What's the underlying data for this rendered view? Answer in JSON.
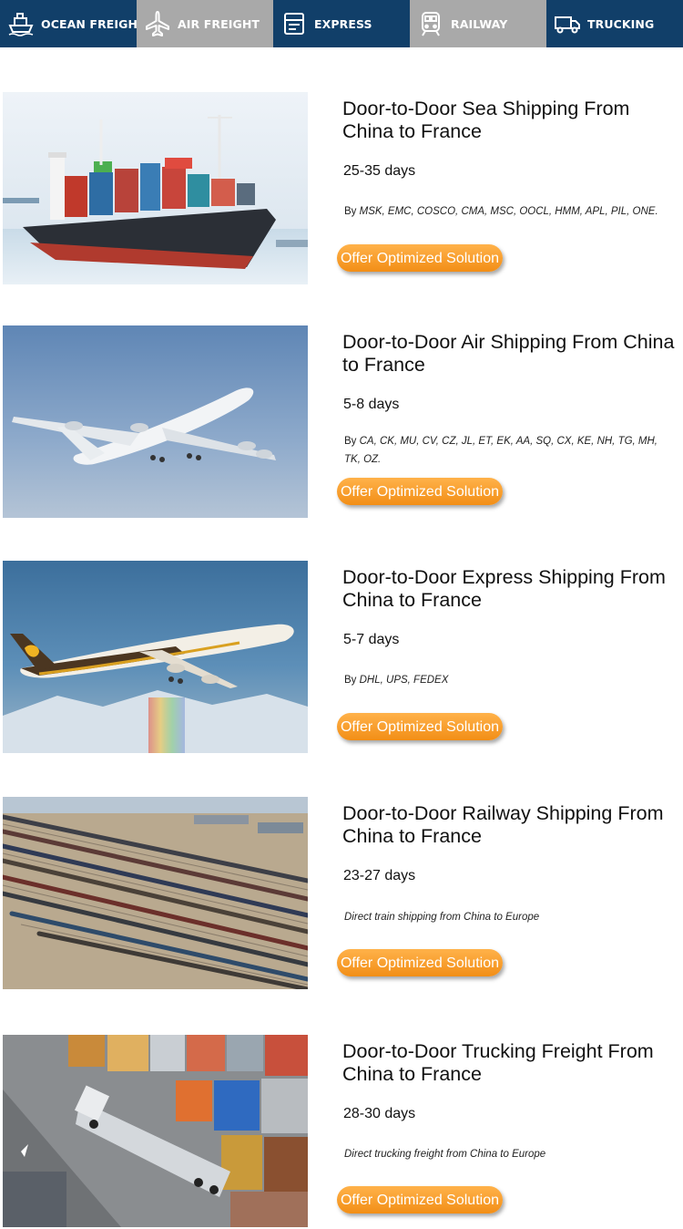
{
  "colors": {
    "tab_active": "#113f69",
    "tab_inactive": "#a9a9a9",
    "cta": "#f7951d"
  },
  "tabs": [
    {
      "label": "OCEAN FREIGHT",
      "icon": "ship-icon",
      "state": "dark"
    },
    {
      "label": "AIR FREIGHT",
      "icon": "airplane-icon",
      "state": "light"
    },
    {
      "label": "EXPRESS",
      "icon": "package-icon",
      "state": "dark"
    },
    {
      "label": "RAILWAY",
      "icon": "train-icon",
      "state": "light"
    },
    {
      "label": "TRUCKING",
      "icon": "truck-icon",
      "state": "dark"
    }
  ],
  "services": [
    {
      "title": "Door-to-Door Sea Shipping From China to France",
      "duration": "25-35 days",
      "carriers_prefix": "By",
      "carriers": "MSK, EMC, COSCO, CMA, MSC, OOCL, HMM, APL, PIL, ONE.",
      "cta": "Offer Optimized Solution",
      "image": "container-ship-photo"
    },
    {
      "title": "Door-to-Door Air Shipping From China to France",
      "duration": "5-8 days",
      "carriers_prefix": "By",
      "carriers": "CA, CK, MU, CV, CZ, JL, ET, EK, AA, SQ, CX, KE, NH, TG, MH, TK, OZ.",
      "cta": "Offer Optimized Solution",
      "image": "cargo-airplane-photo"
    },
    {
      "title": "Door-to-Door Express Shipping From China to France",
      "duration": "5-7 days",
      "carriers_prefix": "By",
      "carriers": "DHL, UPS, FEDEX",
      "cta": "Offer Optimized Solution",
      "image": "ups-airplane-photo"
    },
    {
      "title": "Door-to-Door Railway Shipping From China to France",
      "duration": "23-27 days",
      "carriers_prefix": "",
      "carriers": "Direct train shipping from China to Europe",
      "cta": "Offer Optimized Solution",
      "image": "rail-yard-photo"
    },
    {
      "title": "Door-to-Door Trucking Freight From China to France",
      "duration": "28-30 days",
      "carriers_prefix": "",
      "carriers": "Direct trucking freight from China to Europe",
      "cta": "Offer Optimized Solution",
      "image": "container-truck-photo"
    }
  ]
}
